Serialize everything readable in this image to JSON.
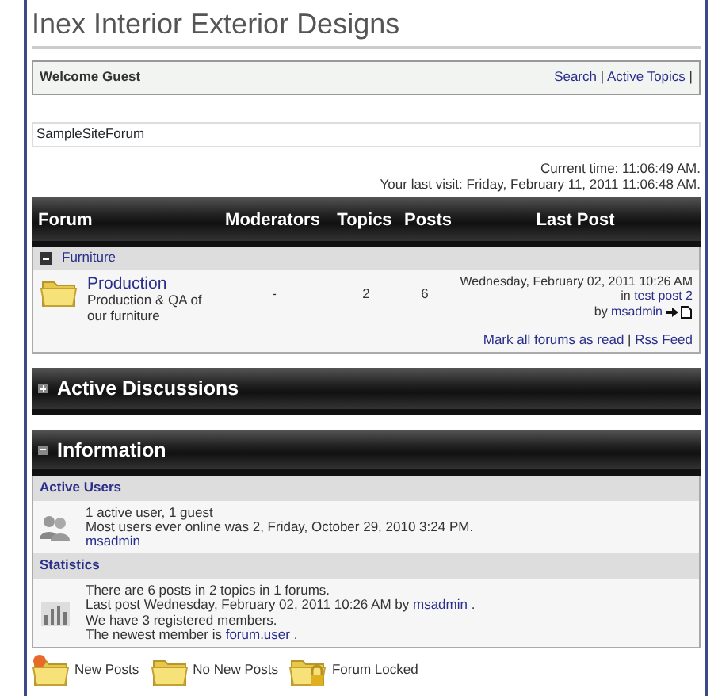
{
  "site_title": "Inex Interior Exterior Designs",
  "welcome_bar": {
    "greeting": "Welcome Guest",
    "links": [
      "Search",
      "Active Topics"
    ],
    "separator": "|"
  },
  "breadcrumb": "SampleSiteForum",
  "times": [
    "Current time: 11:06:49 AM.",
    "Your last visit: Friday, February 11, 2011 11:06:48 AM."
  ],
  "forum_table": {
    "columns": [
      "Forum",
      "Moderators",
      "Topics",
      "Posts",
      "Last Post"
    ],
    "category": {
      "name": "Furniture",
      "expanded": true
    },
    "rows": [
      {
        "name": "Production",
        "description": "Production & QA of our furniture",
        "moderators": "-",
        "topics": "2",
        "posts": "6",
        "last_post": [
          {
            "before": "Wednesday, February 02, 2011 10:26 AM"
          },
          {
            "before": "in ",
            "link": "test post 2"
          },
          {
            "before": "by ",
            "link": "msadmin"
          }
        ]
      }
    ],
    "footer_links": [
      "Mark all forums as read",
      "Rss Feed"
    ],
    "footer_separator": "|"
  },
  "active_discussions": {
    "title": "Active Discussions",
    "expanded": false
  },
  "information": {
    "title": "Information",
    "expanded": true,
    "sections": [
      {
        "title": "Active Users",
        "lines": [
          {
            "before": "1 active user, 1 guest"
          },
          {
            "before": "Most users ever online was 2, Friday, October 29, 2010 3:24 PM."
          },
          {
            "link": "msadmin"
          }
        ]
      },
      {
        "title": "Statistics",
        "lines": [
          {
            "before": "There are 6 posts in 2 topics in 1 forums."
          },
          {
            "before": "Last post Wednesday, February 02, 2011 10:26 AM by ",
            "link": "msadmin",
            "after": " ."
          },
          {
            "before": "We have 3 registered members."
          },
          {
            "before": "The newest member is ",
            "link": "forum.user",
            "after": " ."
          }
        ]
      }
    ]
  },
  "legend": [
    {
      "label": "New Posts",
      "kind": "new"
    },
    {
      "label": "No New Posts",
      "kind": "none"
    },
    {
      "label": "Forum Locked",
      "kind": "locked"
    }
  ]
}
